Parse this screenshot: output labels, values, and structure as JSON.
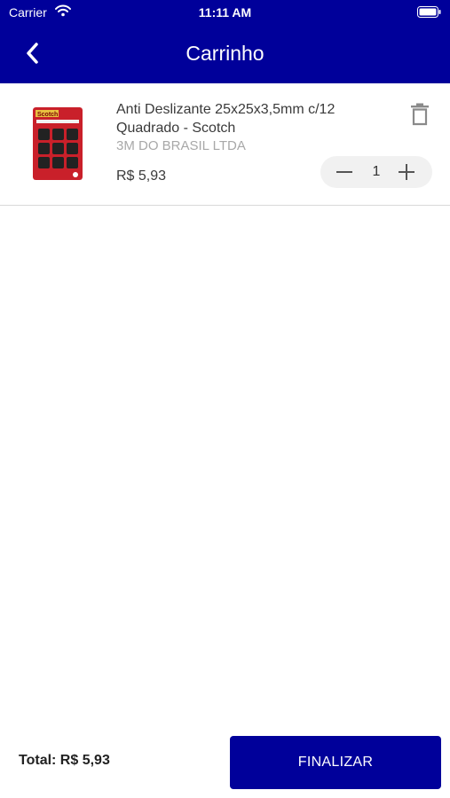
{
  "status_bar": {
    "carrier": "Carrier",
    "time": "11:11 AM"
  },
  "header": {
    "title": "Carrinho",
    "back_icon": "chevron-left-icon",
    "background": "#00009a"
  },
  "cart": {
    "items": [
      {
        "name": "Anti Deslizante 25x25x3,5mm c/12 Quadrado - Scotch",
        "brand": "3M DO BRASIL LTDA",
        "price": "R$ 5,93",
        "quantity": "1",
        "image_label": "Scotch",
        "icons": {
          "delete": "trash-icon",
          "decrement": "minus-icon",
          "increment": "plus-icon"
        }
      }
    ]
  },
  "footer": {
    "total": "Total: R$ 5,93",
    "finalize_label": "FINALIZAR"
  },
  "colors": {
    "primary": "#00009a",
    "muted_text": "#a8a8a8",
    "stepper_bg": "#f1f1f1"
  }
}
